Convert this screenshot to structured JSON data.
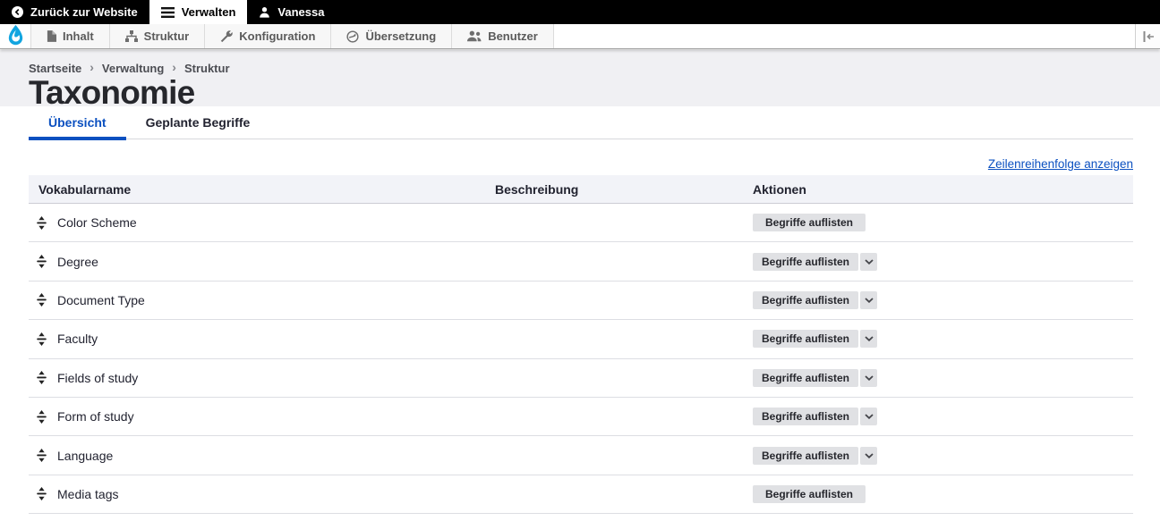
{
  "colors": {
    "accent": "#0b50c0",
    "admin_bar_bg": "#000000",
    "drupal_blue": "#12a5e0",
    "table_header_bg": "#f2f3f8",
    "button_bg": "#e0e1e4",
    "header_band_bg": "#f0f0f3"
  },
  "admin_bar": {
    "back_to_site": "Zurück zur Website",
    "manage": "Verwalten",
    "user": "Vanessa"
  },
  "toolbar": {
    "items": [
      {
        "label": "Inhalt",
        "icon": "document-icon"
      },
      {
        "label": "Struktur",
        "icon": "sitemap-icon"
      },
      {
        "label": "Konfiguration",
        "icon": "wrench-icon"
      },
      {
        "label": "Übersetzung",
        "icon": "globe-icon"
      },
      {
        "label": "Benutzer",
        "icon": "users-icon"
      }
    ],
    "orientation_toggle_icon": "toolbar-orientation-icon"
  },
  "breadcrumb": {
    "items": [
      "Startseite",
      "Verwaltung",
      "Struktur"
    ],
    "separator": "›"
  },
  "page": {
    "title": "Taxonomie"
  },
  "tabs": [
    {
      "label": "Übersicht",
      "active": true
    },
    {
      "label": "Geplante Begriffe",
      "active": false
    }
  ],
  "actions": {
    "show_row_weights": "Zeilenreihenfolge anzeigen"
  },
  "table": {
    "headers": [
      "Vokabularname",
      "Beschreibung",
      "Aktionen"
    ],
    "button_label": "Begriffe auflisten",
    "rows": [
      {
        "name": "Color Scheme",
        "has_dropdown": false
      },
      {
        "name": "Degree",
        "has_dropdown": true
      },
      {
        "name": "Document Type",
        "has_dropdown": true
      },
      {
        "name": "Faculty",
        "has_dropdown": true
      },
      {
        "name": "Fields of study",
        "has_dropdown": true
      },
      {
        "name": "Form of study",
        "has_dropdown": true
      },
      {
        "name": "Language",
        "has_dropdown": true
      },
      {
        "name": "Media tags",
        "has_dropdown": false
      }
    ]
  }
}
